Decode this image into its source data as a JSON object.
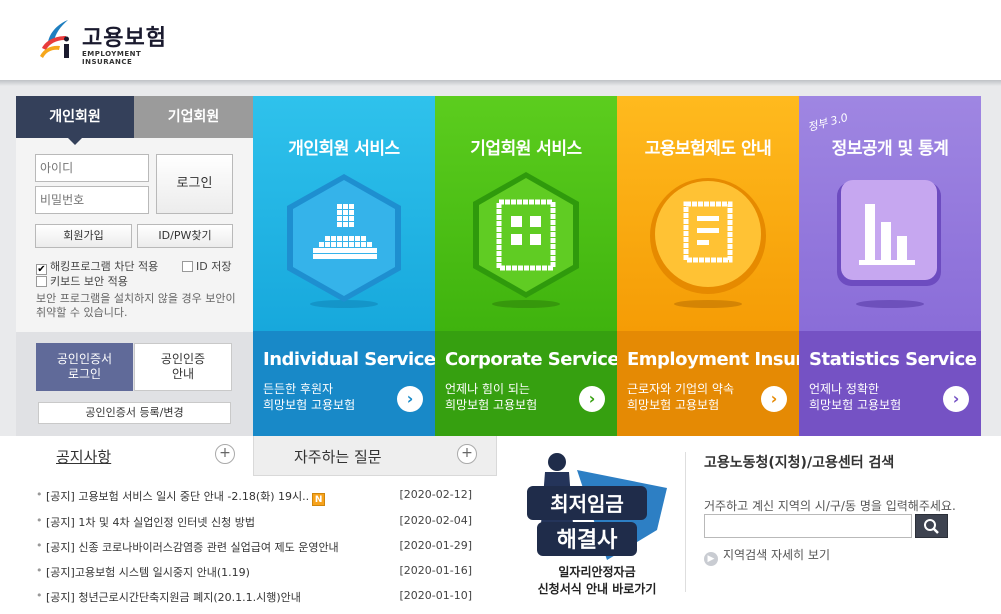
{
  "header": {
    "logo_text": "고용보험",
    "logo_sub": "EMPLOYMENT INSURANCE"
  },
  "login": {
    "tab_personal": "개인회원",
    "tab_corp": "기업회원",
    "id_placeholder": "아이디",
    "pw_placeholder": "비밀번호",
    "login_label": "로그인",
    "join_label": "회원가입",
    "find_label": "ID/PW찾기",
    "chk_hack": "해킹프로그램 차단 적용",
    "chk_id": "ID 저장",
    "chk_kb": "키보드 보안 적용",
    "warning": "보안 프로그램을 설치하지 않을 경우 보안이 취약할 수 있습니다.",
    "cert_login_l1": "공인인증서",
    "cert_login_l2": "로그인",
    "cert_guide_l1": "공인인증",
    "cert_guide_l2": "안내",
    "cert_reg": "공인인증서 등록/변경"
  },
  "services": [
    {
      "ko": "개인회원 서비스",
      "en": "Individual Service",
      "desc1": "든든한 후원자",
      "desc2": "희망보험 고용보험"
    },
    {
      "ko": "기업회원 서비스",
      "en": "Corporate Service",
      "desc1": "언제나 힘이 되는",
      "desc2": "희망보험 고용보험"
    },
    {
      "ko": "고용보험제도 안내",
      "en": "Employment Insurance",
      "desc1": "근로자와 기업의 약속",
      "desc2": "희망보험 고용보험"
    },
    {
      "ko": "정보공개 및 통계",
      "en": "Statistics Service",
      "desc1": "언제나 정확한",
      "desc2": "희망보험 고용보험",
      "badge": "정부 3.0"
    }
  ],
  "notice": {
    "tab_notice": "공지사항",
    "tab_faq": "자주하는 질문",
    "plus": "+",
    "items": [
      {
        "title": "[공지] 고용보험 서비스 일시 중단 안내 -2.18(화) 19시..",
        "date": "[2020-02-12]",
        "new": "N"
      },
      {
        "title": "[공지] 1차 및 4차 실업인정 인터넷 신청 방법",
        "date": "[2020-02-04]"
      },
      {
        "title": "[공지] 신종 코로나바이러스감염증 관련 실업급여 제도 운영안내",
        "date": "[2020-01-29]"
      },
      {
        "title": "[공지]고용보험 시스템 일시중지 안내(1.19)",
        "date": "[2020-01-16]"
      },
      {
        "title": "[공지] 청년근로시간단축지원금 폐지(20.1.1.시행)안내",
        "date": "[2020-01-10]"
      }
    ]
  },
  "banner": {
    "headline1": "최저임금",
    "headline2": "해결사",
    "line1": "일자리안정자금",
    "line2": "신청서식 안내 바로가기"
  },
  "search": {
    "title": "고용노동청(지청)/고용센터 검색",
    "desc": "거주하고 계신 지역의 시/구/동 명을 입력해주세요.",
    "detail": "지역검색 자세히 보기"
  },
  "colors": {
    "navy": "#34405a",
    "cyan": "#17a8dc",
    "green": "#3fb30e",
    "orange": "#f59c05",
    "purple": "#8a6dd8"
  }
}
